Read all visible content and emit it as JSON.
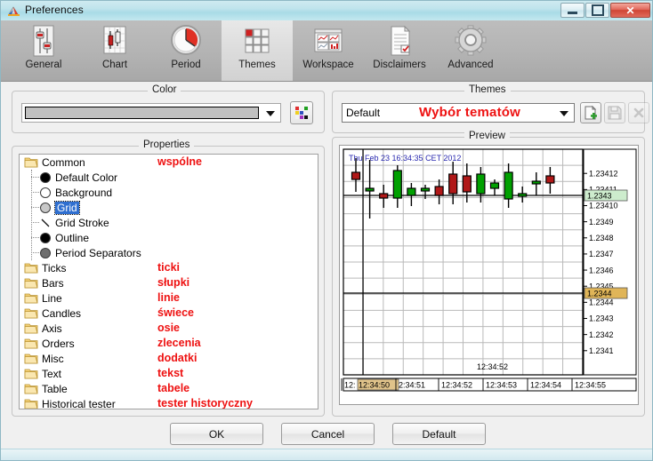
{
  "window": {
    "title": "Preferences",
    "icon": "app-icon",
    "buttons": {
      "minimize": "minimize-icon",
      "maximize": "maximize-icon",
      "close": "✕"
    }
  },
  "toolbar": {
    "items": [
      {
        "label": "General",
        "icon": "sliders-icon",
        "active": false
      },
      {
        "label": "Chart",
        "icon": "candlestick-icon",
        "active": false
      },
      {
        "label": "Period",
        "icon": "clock-icon",
        "active": false
      },
      {
        "label": "Themes",
        "icon": "grid-tiles-icon",
        "active": true
      },
      {
        "label": "Workspace",
        "icon": "windows-icon",
        "active": false
      },
      {
        "label": "Disclaimers",
        "icon": "document-icon",
        "active": false
      },
      {
        "label": "Advanced",
        "icon": "gear-icon",
        "active": false
      }
    ]
  },
  "color_group": {
    "legend": "Color",
    "selected_color": "#c0c0c0",
    "dropdown_icon": "chevron-down-icon",
    "palette_button_icon": "palette-icon"
  },
  "themes_group": {
    "legend": "Themes",
    "selected_theme": "Default",
    "annotation": "Wybór tematów",
    "annotation_color": "#ee1111",
    "dropdown_icon": "chevron-down-icon",
    "buttons": [
      {
        "name": "new-theme-button",
        "icon": "new-page-plus-icon",
        "enabled": true
      },
      {
        "name": "save-theme-button",
        "icon": "floppy-disk-icon",
        "enabled": false
      },
      {
        "name": "delete-theme-button",
        "icon": "close-x-icon",
        "enabled": false
      }
    ]
  },
  "properties_group": {
    "legend": "Properties",
    "tree": [
      {
        "label": "Common",
        "type": "folder",
        "annotation": "wspólne",
        "selected": false
      },
      {
        "label": "Default Color",
        "type": "circle",
        "swatch": "#000000",
        "annotation": "",
        "selected": false
      },
      {
        "label": "Background",
        "type": "circle",
        "swatch": "#ffffff",
        "annotation": "",
        "selected": false
      },
      {
        "label": "Grid",
        "type": "circle",
        "swatch": "#c8c8c8",
        "annotation": "",
        "selected": true
      },
      {
        "label": "Grid Stroke",
        "type": "stroke",
        "annotation": "",
        "selected": false
      },
      {
        "label": "Outline",
        "type": "circle",
        "swatch": "#000000",
        "annotation": "",
        "selected": false
      },
      {
        "label": "Period Separators",
        "type": "circle",
        "swatch": "#6e6e6e",
        "annotation": "",
        "selected": false
      },
      {
        "label": "Ticks",
        "type": "folder",
        "annotation": "ticki",
        "selected": false
      },
      {
        "label": "Bars",
        "type": "folder",
        "annotation": "słupki",
        "selected": false
      },
      {
        "label": "Line",
        "type": "folder",
        "annotation": "linie",
        "selected": false
      },
      {
        "label": "Candles",
        "type": "folder",
        "annotation": "świece",
        "selected": false
      },
      {
        "label": "Axis",
        "type": "folder",
        "annotation": "osie",
        "selected": false
      },
      {
        "label": "Orders",
        "type": "folder",
        "annotation": "zlecenia",
        "selected": false
      },
      {
        "label": "Misc",
        "type": "folder",
        "annotation": "dodatki",
        "selected": false
      },
      {
        "label": "Text",
        "type": "folder",
        "annotation": "tekst",
        "selected": false
      },
      {
        "label": "Table",
        "type": "folder",
        "annotation": "tabele",
        "selected": false
      },
      {
        "label": "Historical tester",
        "type": "folder",
        "annotation": "tester historyczny",
        "selected": false
      }
    ]
  },
  "preview_group": {
    "legend": "Preview",
    "chart_title": "Thu Feb 23 16:34:35 CET 2012"
  },
  "chart_data": {
    "type": "candlestick",
    "title": "Thu Feb 23 16:34:35 CET 2012",
    "xlabel": "",
    "ylabel": "",
    "grid": true,
    "legend": "none",
    "y_tick_labels": [
      "1.23412",
      "1.23411",
      "1.23410",
      "1.2349",
      "1.2348",
      "1.2347",
      "1.2346",
      "1.2345",
      "1.2344",
      "1.2343",
      "1.2342",
      "1.2341"
    ],
    "y_axis_highlights": [
      {
        "value": "1.2343",
        "color": "#cdeccd",
        "role": "current-bid-label"
      },
      {
        "value": "1.2344",
        "color": "#e0b558",
        "role": "crosshair-price-label"
      }
    ],
    "x_tick_labels": [
      "12:",
      "12:34:50",
      "2:34:51",
      "12:34:52",
      "12:34:53",
      "12:34:54",
      "12:34:55"
    ],
    "x_axis_highlight": {
      "value": "12:34:50",
      "color": "#e0c38a",
      "role": "crosshair-time-label"
    },
    "crosshair_time_label": "12:34:52",
    "price_lines": [
      {
        "value": "1.23410",
        "style": "solid-black"
      },
      {
        "value": "1.2344",
        "style": "solid-black"
      }
    ],
    "up_color": "#00a000",
    "down_color": "#b01818",
    "candles": [
      {
        "o": 26,
        "h": 10,
        "l": 48,
        "c": 34,
        "dir": "down"
      },
      {
        "o": 46,
        "h": 12,
        "l": 78,
        "c": 44,
        "dir": "up"
      },
      {
        "o": 55,
        "h": 40,
        "l": 66,
        "c": 50,
        "dir": "down"
      },
      {
        "o": 55,
        "h": 18,
        "l": 66,
        "c": 24,
        "dir": "up"
      },
      {
        "o": 52,
        "h": 38,
        "l": 64,
        "c": 44,
        "dir": "up"
      },
      {
        "o": 46,
        "h": 40,
        "l": 56,
        "c": 44,
        "dir": "up"
      },
      {
        "o": 52,
        "h": 34,
        "l": 62,
        "c": 42,
        "dir": "down"
      },
      {
        "o": 50,
        "h": 14,
        "l": 62,
        "c": 28,
        "dir": "down"
      },
      {
        "o": 48,
        "h": 16,
        "l": 60,
        "c": 30,
        "dir": "down"
      },
      {
        "o": 50,
        "h": 20,
        "l": 60,
        "c": 28,
        "dir": "up"
      },
      {
        "o": 44,
        "h": 34,
        "l": 52,
        "c": 38,
        "dir": "up"
      },
      {
        "o": 56,
        "h": 16,
        "l": 66,
        "c": 26,
        "dir": "up"
      },
      {
        "o": 53,
        "h": 42,
        "l": 60,
        "c": 50,
        "dir": "up"
      },
      {
        "o": 37,
        "h": 26,
        "l": 52,
        "c": 36,
        "dir": "up"
      },
      {
        "o": 38,
        "h": 20,
        "l": 50,
        "c": 30,
        "dir": "down"
      }
    ]
  },
  "footer": {
    "ok_label": "OK",
    "cancel_label": "Cancel",
    "default_label": "Default"
  }
}
